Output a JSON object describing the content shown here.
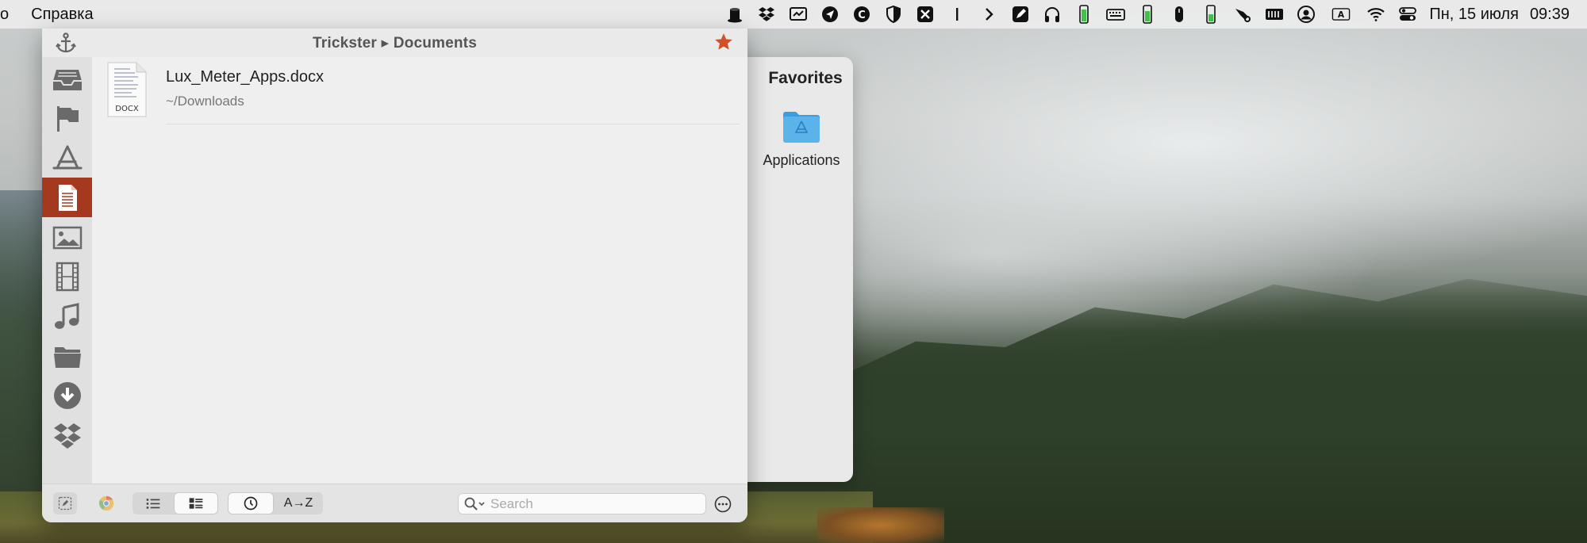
{
  "menubar": {
    "partial_item": "о",
    "help": "Справка",
    "date": "Пн, 15 июля",
    "time": "09:39",
    "keyboard_layout": "A"
  },
  "window": {
    "title": "Trickster ▸ Documents"
  },
  "sidebar": {
    "items": [
      "inbox",
      "flagged",
      "applications",
      "documents",
      "pictures",
      "movies",
      "music",
      "folders",
      "downloads",
      "dropbox"
    ],
    "active": "documents",
    "accent_color": "#a5391f"
  },
  "files": [
    {
      "name": "Lux_Meter_Apps.docx",
      "path": "~/Downloads",
      "icon_label": "DOCX"
    }
  ],
  "toolbar": {
    "sort_alpha_label": "A→Z",
    "search_placeholder": "Search",
    "view_mode": "detail",
    "sort_mode": "recent"
  },
  "favorites": {
    "title": "Favorites",
    "items": [
      {
        "label": "Applications"
      }
    ]
  },
  "colors": {
    "star": "#d1502a",
    "folder": "#5ab4ea"
  }
}
